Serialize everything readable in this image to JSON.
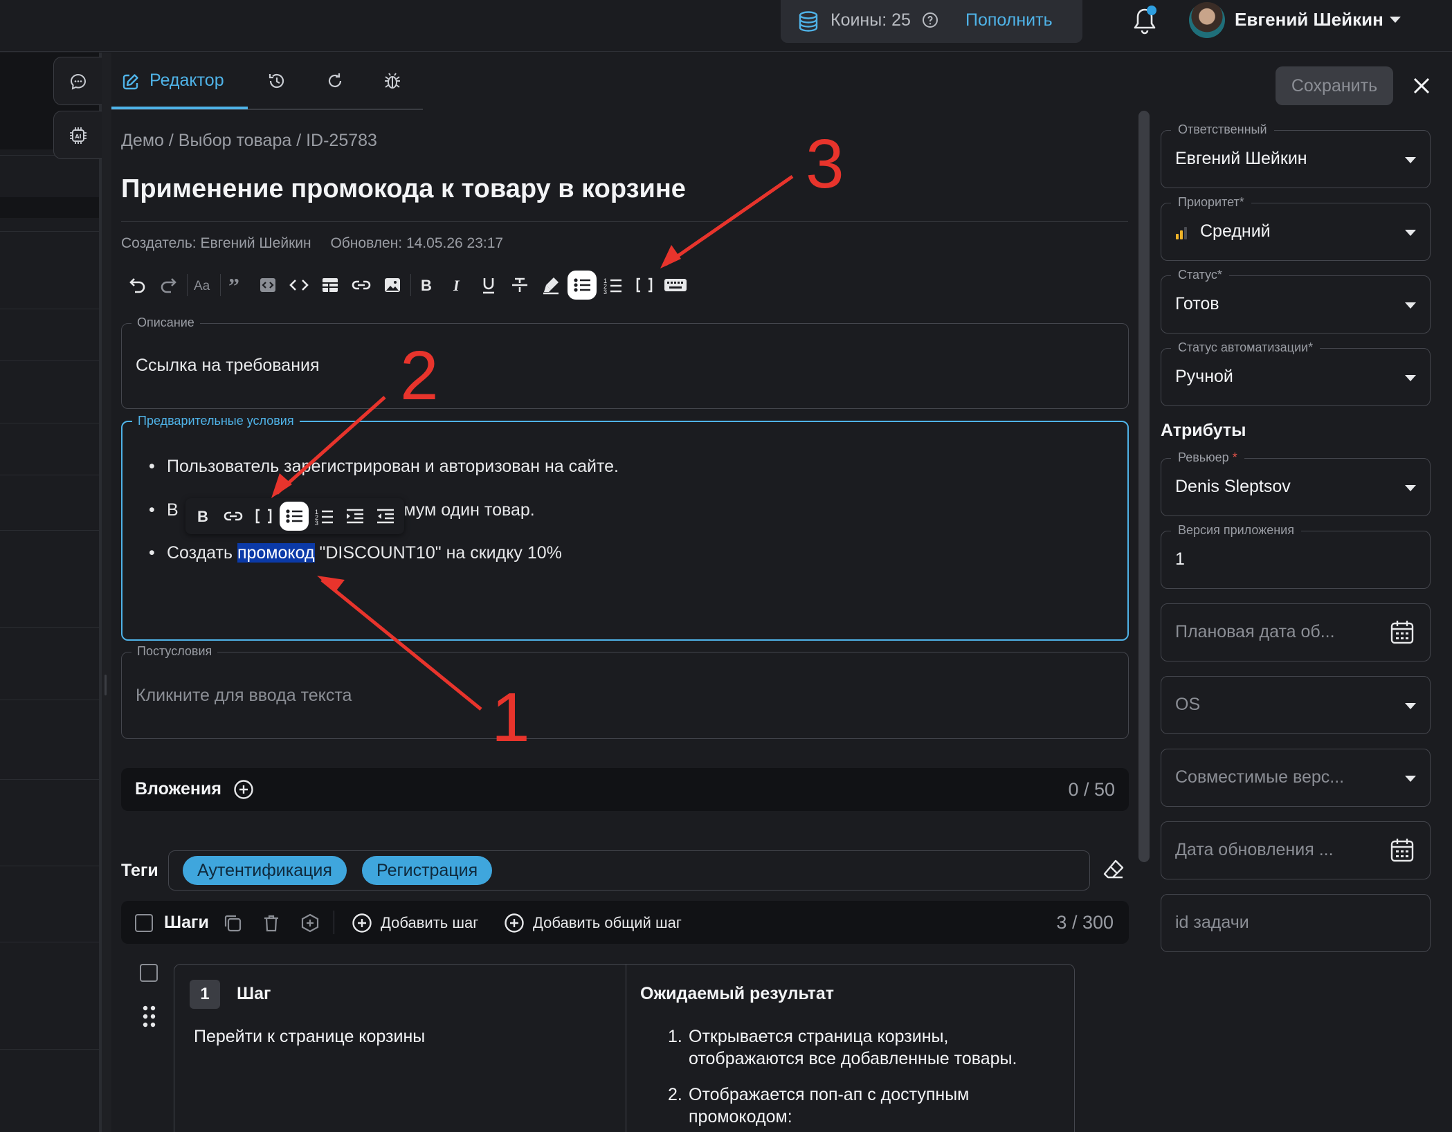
{
  "header": {
    "coins_label": "Коины: 25",
    "coins_topup": "Пополнить",
    "user_name": "Евгений Шейкин"
  },
  "tabs": {
    "editor_label": "Редактор"
  },
  "actions": {
    "save_label": "Сохранить"
  },
  "main": {
    "breadcrumb": "Демо / Выбор товара / ID-25783",
    "title": "Применение промокода к товару в корзине",
    "creator": "Создатель: Евгений Шейкин",
    "updated": "Обновлен: 14.05.26 23:17"
  },
  "description": {
    "legend": "Описание",
    "text": "Ссылка на требования"
  },
  "preconditions": {
    "legend": "Предварительные условия",
    "item1": "Пользователь зарегистрирован и авторизован на сайте.",
    "item2_start": "В",
    "item2_end": "инимум один товар.",
    "item3_before": "Создать ",
    "item3_highlight": "промокод",
    "item3_after": " \"DISCOUNT10\" на скидку 10%"
  },
  "postconditions": {
    "legend": "Постусловия",
    "placeholder": "Кликните для ввода текста"
  },
  "attachments": {
    "label": "Вложения",
    "count": "0 / 50"
  },
  "tags": {
    "label": "Теги",
    "items": [
      "Аутентификация",
      "Регистрация"
    ]
  },
  "steps": {
    "label": "Шаги",
    "add_step": "Добавить шаг",
    "add_common_step": "Добавить общий шаг",
    "count": "3 / 300",
    "card": {
      "number": "1",
      "step_header": "Шаг",
      "step_text": "Перейти к странице корзины",
      "expected_header": "Ожидаемый результат",
      "expected_items": [
        "Открывается страница корзины, отображаются все добавленные товары.",
        "Отображается поп-ап с доступным промокодом:"
      ]
    }
  },
  "right_panel": {
    "assignee_legend": "Ответственный",
    "assignee_value": "Евгений Шейкин",
    "priority_legend": "Приоритет*",
    "priority_value": "Средний",
    "status_legend": "Статус*",
    "status_value": "Готов",
    "auto_status_legend": "Статус автоматизации*",
    "auto_status_value": "Ручной",
    "attributes_title": "Атрибуты",
    "reviewer_legend": "Ревьюер",
    "reviewer_required": "*",
    "reviewer_value": "Denis Sleptsov",
    "app_version_legend": "Версия приложения",
    "app_version_value": "1",
    "planned_date_placeholder": "Плановая дата об...",
    "os_placeholder": "OS",
    "compatible_placeholder": "Совместимые верс...",
    "update_date_placeholder": "Дата обновления ...",
    "task_id_placeholder": "id задачи"
  },
  "annotations": {
    "one": "1",
    "two": "2",
    "three": "3"
  },
  "colors": {
    "accent": "#4fb3e8",
    "tag": "#3fa6dd",
    "highlight": "#0b3aa8",
    "annotation": "#e8342c",
    "priority": "#f0b429"
  }
}
